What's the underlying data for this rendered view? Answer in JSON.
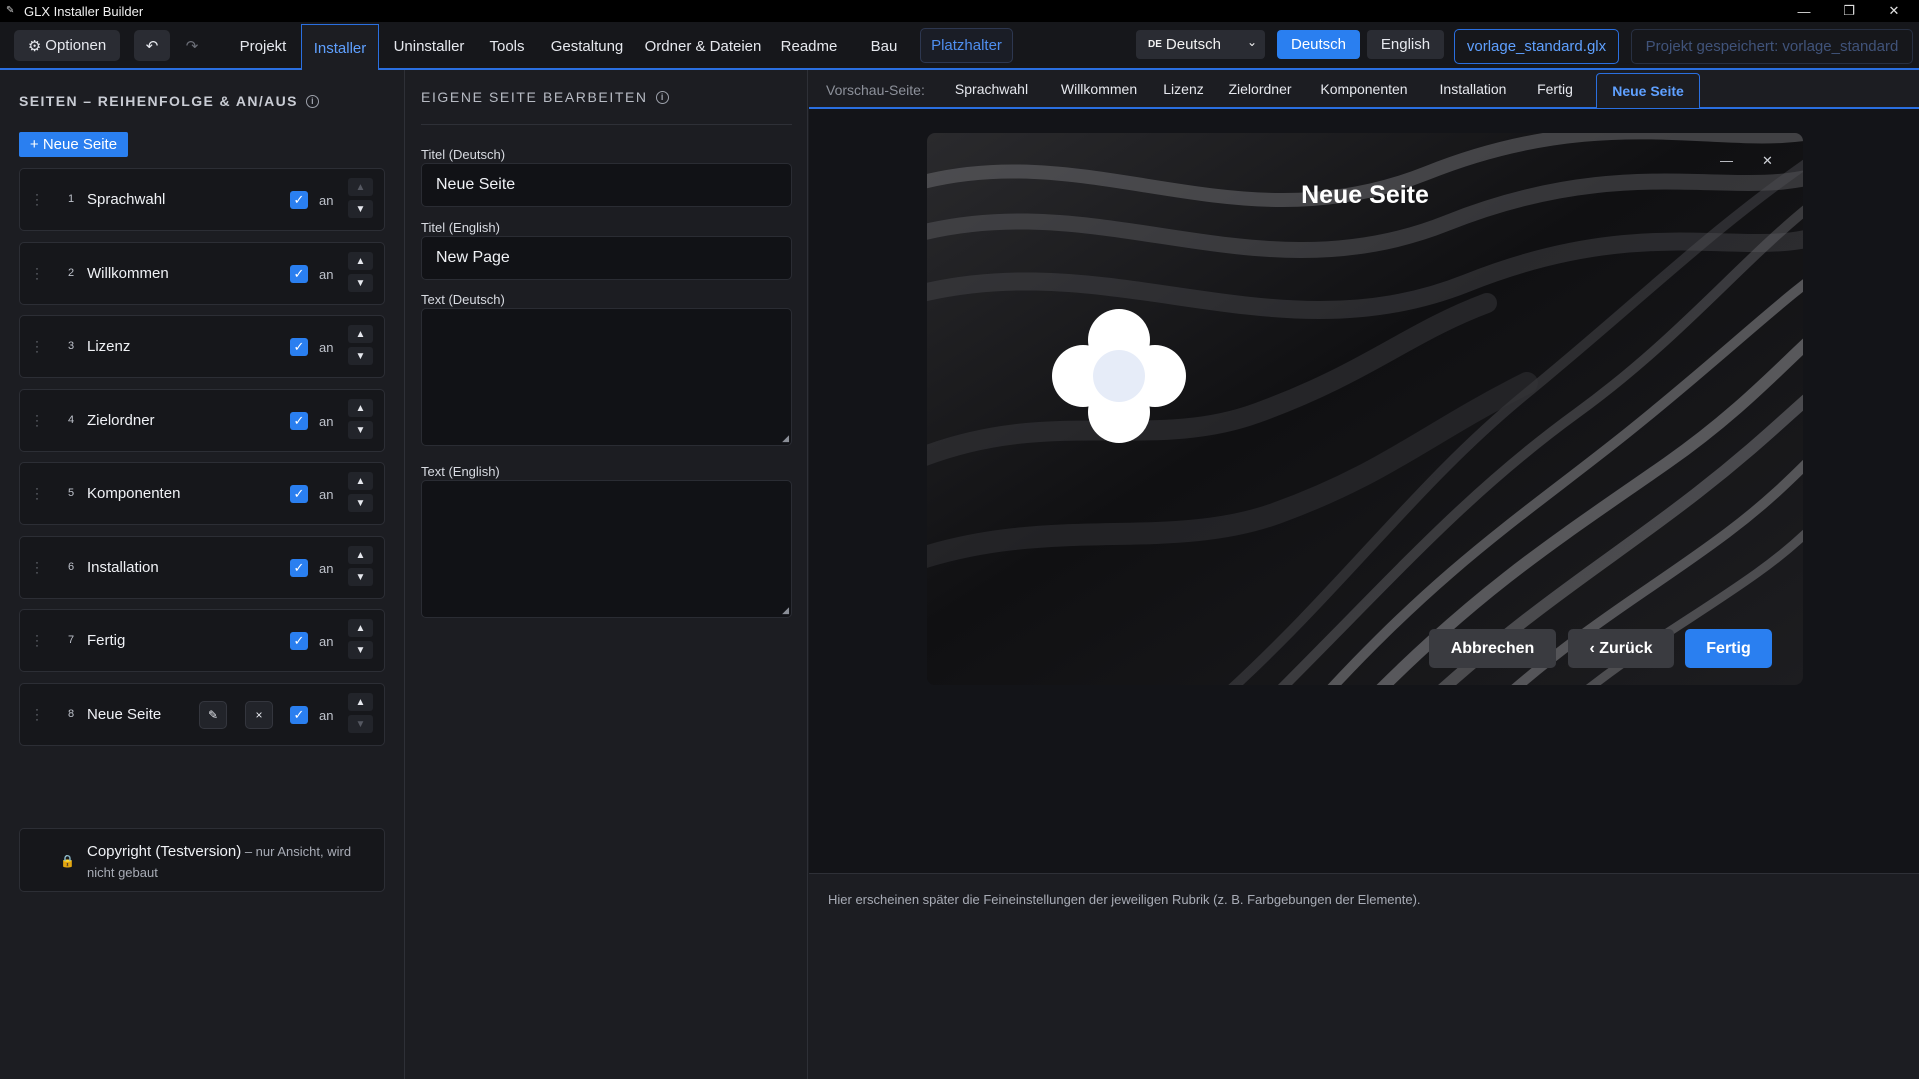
{
  "window": {
    "title": "GLX Installer Builder",
    "minimize": "—",
    "restore": "❐",
    "close": "✕"
  },
  "toolbar": {
    "options_label": "Optionen",
    "undo": "↶",
    "redo": "↷",
    "tabs": [
      "Projekt",
      "Installer",
      "Uninstaller",
      "Tools",
      "Gestaltung",
      "Ordner & Dateien",
      "Readme",
      "Bau"
    ],
    "active_tab": "Installer",
    "placeholder_label": "Platzhalter",
    "lang_select": {
      "flag": "DE",
      "value": "Deutsch"
    },
    "lang_buttons": [
      "Deutsch",
      "English"
    ],
    "active_lang": "Deutsch",
    "file_label": "vorlage_standard.glx",
    "saved_label": "Projekt gespeichert: vorlage_standard"
  },
  "pages_panel": {
    "heading": "SEITEN – REIHENFOLGE & AN/AUS",
    "new_page_label": "+ Neue Seite",
    "items": [
      {
        "num": "1",
        "name": "Sprachwahl",
        "enabled": true,
        "state": "an"
      },
      {
        "num": "2",
        "name": "Willkommen",
        "enabled": true,
        "state": "an"
      },
      {
        "num": "3",
        "name": "Lizenz",
        "enabled": true,
        "state": "an"
      },
      {
        "num": "4",
        "name": "Zielordner",
        "enabled": true,
        "state": "an"
      },
      {
        "num": "5",
        "name": "Komponenten",
        "enabled": true,
        "state": "an"
      },
      {
        "num": "6",
        "name": "Installation",
        "enabled": true,
        "state": "an"
      },
      {
        "num": "7",
        "name": "Fertig",
        "enabled": true,
        "state": "an"
      },
      {
        "num": "8",
        "name": "Neue Seite",
        "enabled": true,
        "state": "an"
      }
    ],
    "copyright": {
      "title": "Copyright (Testversion)",
      "note": " – nur Ansicht, wird nicht gebaut"
    }
  },
  "edit_panel": {
    "heading": "EIGENE SEITE BEARBEITEN",
    "title_de_label": "Titel (Deutsch)",
    "title_de_value": "Neue Seite",
    "title_en_label": "Titel (English)",
    "title_en_value": "New Page",
    "text_de_label": "Text (Deutsch)",
    "text_en_label": "Text (English)"
  },
  "preview": {
    "label": "Vorschau-Seite:",
    "tabs": [
      "Sprachwahl",
      "Willkommen",
      "Lizenz",
      "Zielordner",
      "Komponenten",
      "Installation",
      "Fertig",
      "Neue Seite"
    ],
    "active_tab": "Neue Seite",
    "window_title": "Neue Seite",
    "minimize": "—",
    "close": "✕",
    "cancel_label": "Abbrechen",
    "back_label": "‹ Zurück",
    "done_label": "Fertig",
    "bottom_note": "Hier erscheinen später die Feineinstellungen der jeweiligen Rubrik (z. B. Farbgebungen der Elemente)."
  },
  "colors": {
    "accent": "#2a7ff0",
    "background": "#1c1d22",
    "dark": "#16171b",
    "lock": "#e7b94a"
  }
}
